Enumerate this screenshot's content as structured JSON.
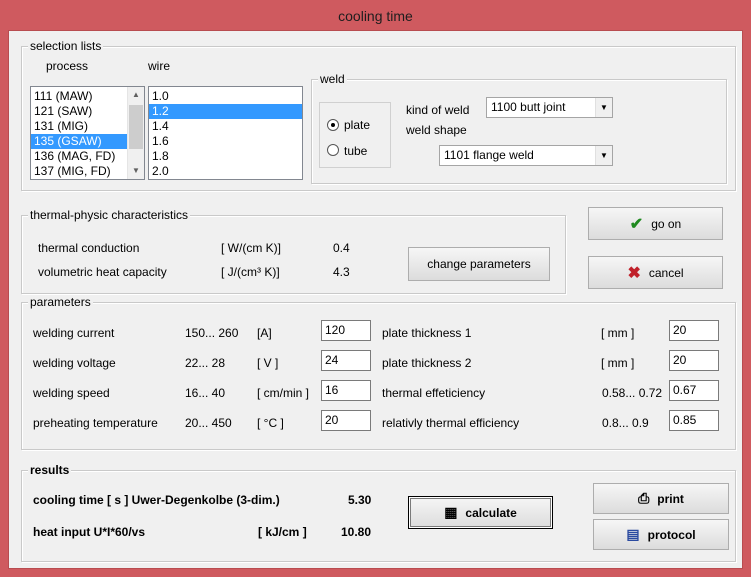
{
  "window": {
    "title": "cooling time"
  },
  "selection": {
    "label": "selection lists",
    "process_label": "process",
    "wire_label": "wire",
    "process_items": [
      "111  (MAW)",
      "121  (SAW)",
      "131  (MIG)",
      "135  (GSAW)",
      "136  (MAG, FD)",
      "137  (MIG, FD)"
    ],
    "process_selected": "135  (GSAW)",
    "wire_items": [
      "1.0",
      "1.2",
      "1.4",
      "1.6",
      "1.8",
      "2.0"
    ],
    "wire_selected": "1.2"
  },
  "weld": {
    "label": "weld",
    "plate_label": "plate",
    "tube_label": "tube",
    "selected_shape": "plate",
    "kind_label": "kind of weld",
    "kind_value": "1100  butt joint",
    "shape_label": "weld shape",
    "shape_value": "1101  flange weld"
  },
  "thermal": {
    "label": "thermal-physic characteristics",
    "conduction_label": "thermal conduction",
    "conduction_unit": "[ W/(cm K)]",
    "conduction_value": "0.4",
    "capacity_label": "volumetric heat capacity",
    "capacity_unit": "[ J/(cm³ K)]",
    "capacity_value": "4.3",
    "change_button": "change parameters"
  },
  "actions": {
    "go_on": "go on",
    "cancel": "cancel",
    "print": "print",
    "protocol": "protocol",
    "calculate": "calculate"
  },
  "parameters": {
    "label": "parameters",
    "left": [
      {
        "label": "welding current",
        "range": "150... 260",
        "unit": "[A]",
        "value": "120"
      },
      {
        "label": "welding voltage",
        "range": "22... 28",
        "unit": "[ V ]",
        "value": "24"
      },
      {
        "label": "welding speed",
        "range": "16... 40",
        "unit": "[ cm/min ]",
        "value": "16"
      },
      {
        "label": "preheating temperature",
        "range": "20... 450",
        "unit": "[ °C ]",
        "value": "20"
      }
    ],
    "right": [
      {
        "label": "plate thickness 1",
        "range": "[ mm ]",
        "value": "20"
      },
      {
        "label": "plate thickness 2",
        "range": "[ mm ]",
        "value": "20"
      },
      {
        "label": "thermal effeticiency",
        "range": "0.58... 0.72",
        "value": "0.67"
      },
      {
        "label": "relativly thermal efficiency",
        "range": "0.8... 0.9",
        "value": "0.85"
      }
    ]
  },
  "results": {
    "label": "results",
    "cooling_label": "cooling time [ s ]  Uwer-Degenkolbe (3-dim.)",
    "cooling_value": "5.30",
    "heat_label": "heat input  U*I*60/vs",
    "heat_unit": "[ kJ/cm ]",
    "heat_value": "10.80"
  }
}
